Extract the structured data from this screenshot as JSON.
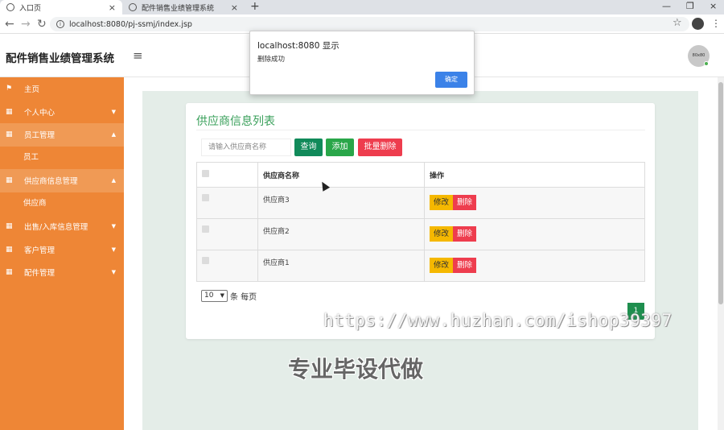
{
  "browser": {
    "tabs": [
      {
        "title": "入口页",
        "active": true
      },
      {
        "title": "配件销售业绩管理系统",
        "active": false
      }
    ],
    "url": "localhost:8080/pj-ssmj/index.jsp",
    "icons": {
      "back": "←",
      "forward": "→",
      "reload": "↻",
      "new_tab": "+",
      "close": "×",
      "star": "☆",
      "menu": "⋮"
    }
  },
  "header": {
    "brand": "配件销售业绩管理系统",
    "menu_icon": "≡",
    "avatar_text": "80x80"
  },
  "sidebar": {
    "items": [
      {
        "label": "主页",
        "icon": "flag-icon",
        "glyph": "⚑",
        "caret": false,
        "open": false
      },
      {
        "label": "个人中心",
        "icon": "grid-icon",
        "glyph": "▦",
        "caret": true,
        "open": false
      },
      {
        "label": "员工管理",
        "icon": "grid-icon",
        "glyph": "▦",
        "caret": true,
        "open": true
      },
      {
        "label": "员工",
        "sub": true
      },
      {
        "label": "供应商信息管理",
        "icon": "grid-icon",
        "glyph": "▦",
        "caret": true,
        "open": true
      },
      {
        "label": "供应商",
        "sub": true
      },
      {
        "label": "出售/入库信息管理",
        "icon": "grid-icon",
        "glyph": "▦",
        "caret": true,
        "open": false
      },
      {
        "label": "客户管理",
        "icon": "grid-icon",
        "glyph": "▦",
        "caret": true,
        "open": false
      },
      {
        "label": "配件管理",
        "icon": "grid-icon",
        "glyph": "▦",
        "caret": true,
        "open": false
      }
    ]
  },
  "main": {
    "title": "供应商信息列表",
    "search_placeholder": "请输入供应商名称",
    "buttons": {
      "query": "查询",
      "add": "添加",
      "batch_delete": "批量删除"
    },
    "table": {
      "headers": [
        "",
        "供应商名称",
        "操作"
      ],
      "rows": [
        {
          "name": "供应商3"
        },
        {
          "name": "供应商2"
        },
        {
          "name": "供应商1"
        }
      ],
      "edit_label": "修改",
      "delete_label": "删除"
    },
    "pager": {
      "page_size": "10",
      "suffix": "条 每页",
      "current_page": "1"
    }
  },
  "alert": {
    "title": "localhost:8080 显示",
    "message": "删除成功",
    "ok": "确定"
  },
  "overlays": {
    "watermark_url": "https://www.huzhan.com/ishop39397",
    "watermark_text": "专业毕设代做"
  },
  "colors": {
    "sidebar": "#ee8636",
    "title_green": "#3aa05b",
    "query": "#118a5a",
    "add": "#29a649",
    "danger": "#ee3d4e",
    "warning": "#f5b800",
    "alert_ok": "#3b82e8"
  }
}
